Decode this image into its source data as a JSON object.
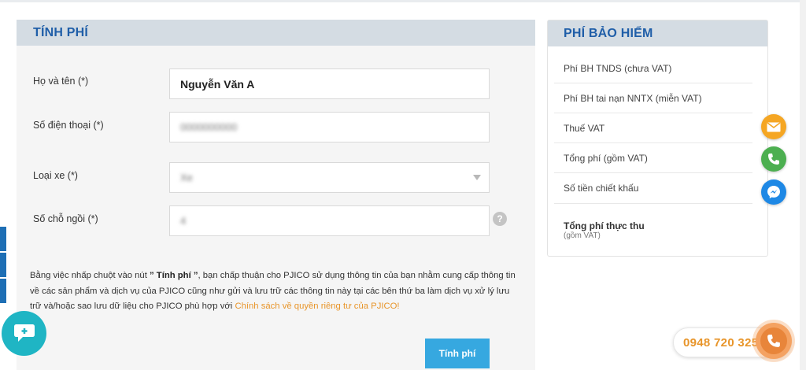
{
  "form": {
    "title": "TÍNH PHÍ",
    "fields": [
      {
        "label": "Họ và tên (*)",
        "value": "Nguyễn Văn A"
      },
      {
        "label": "Số điện thoại (*)",
        "value": "0000000000"
      },
      {
        "label": "Loại xe (*)",
        "value": "Xe"
      },
      {
        "label": "Số chỗ ngồi (*)",
        "value": "4"
      }
    ],
    "help_icon": "?",
    "consent": {
      "prefix": "Bằng việc nhấp chuột vào nút ",
      "button_ref": "” Tính phí ”",
      "body": ", bạn chấp thuận cho PJICO sử dụng thông tin của bạn nhằm cung cấp thông tin về các sản phẩm và dịch vụ của PJICO cũng như gửi và lưu trữ các thông tin này tại các bên thứ ba làm dịch vụ xử lý lưu trữ và/hoặc sao lưu dữ liệu cho PJICO phù hợp với ",
      "link": "Chính sách về quyền riêng tư của PJICO!"
    },
    "submit_label": "Tính phí"
  },
  "insurance": {
    "title": "PHÍ BẢO HIỂM",
    "rows": [
      "Phí BH TNDS (chưa VAT)",
      "Phí BH tai nạn NNTX (miễn VAT)",
      "Thuế VAT",
      "Tổng phí (gồm VAT)",
      "Số tiền chiết khấu"
    ],
    "total_label": "Tổng phí thực thu",
    "total_sub": "(gồm VAT)"
  },
  "hotline": {
    "number": "0948 720 325"
  },
  "icons": {
    "mail": "mail-icon",
    "call": "phone-icon",
    "messenger": "messenger-icon",
    "chat": "chat-icon",
    "hotline": "phone-icon"
  },
  "colors": {
    "header_text": "#1f5ea8",
    "header_bg": "#d4dce3",
    "button": "#36a8e0",
    "link": "#e8952a",
    "mail": "#f5a623",
    "call": "#4caf50",
    "messenger": "#1e88e5",
    "chat": "#1fb5c4"
  }
}
